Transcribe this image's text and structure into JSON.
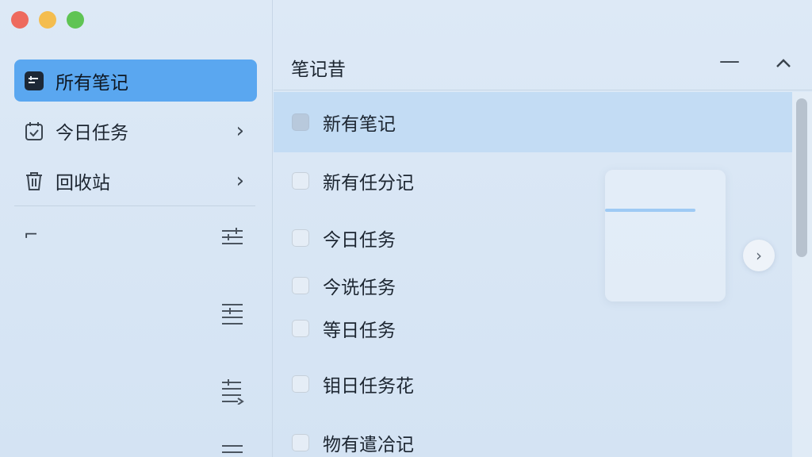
{
  "sidebar": {
    "items": [
      {
        "label": "所有笔记",
        "icon": "notes-icon",
        "active": true
      },
      {
        "label": "今日任务",
        "icon": "calendar-check-icon",
        "chevron": true
      },
      {
        "label": "回收站",
        "icon": "trash-icon",
        "chevron": true
      }
    ],
    "collapse_glyph": "⌐"
  },
  "main": {
    "title": "笔记昔",
    "rows": [
      {
        "label": "新有笔记",
        "selected": true
      },
      {
        "label": "新有任分记"
      },
      {
        "label": "今日任务"
      },
      {
        "label": "今诜任务"
      },
      {
        "label": "等日任务"
      },
      {
        "label": "钼日任务花"
      },
      {
        "label": "物有遣冾记"
      }
    ]
  },
  "colors": {
    "accent": "#5aa7f0",
    "selected_row": "#c3dcf4",
    "background": "#d9e7f6"
  }
}
